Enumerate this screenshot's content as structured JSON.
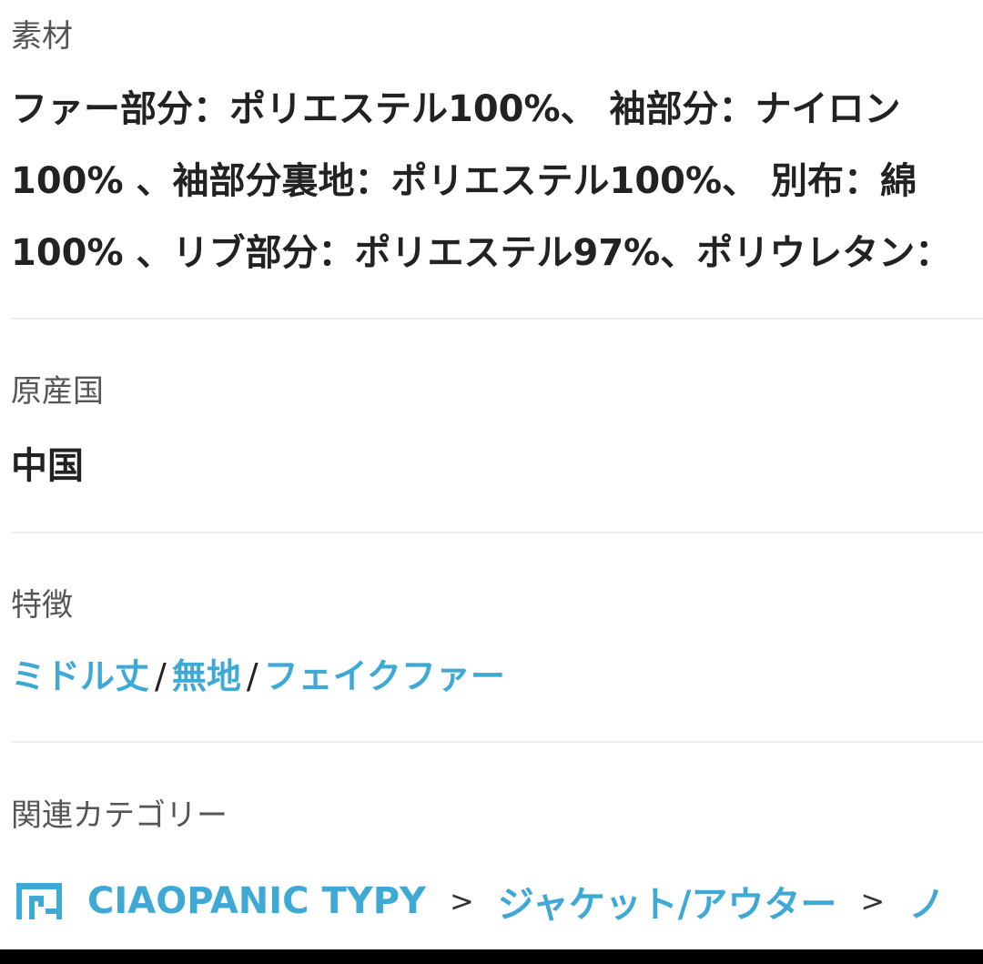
{
  "material": {
    "label": "素材",
    "lines": [
      "ファー部分：ポリエステル100%、 袖部分：ナイロン",
      "100% 、袖部分裏地：ポリエステル100%、 別布：綿",
      "100% 、リブ部分：ポリエステル97%、ポリウレタン："
    ]
  },
  "origin": {
    "label": "原産国",
    "value": "中国"
  },
  "features": {
    "label": "特徴",
    "tags": [
      "ミドル丈",
      "無地",
      "フェイクファー"
    ],
    "separator": "/"
  },
  "related_categories": {
    "label": "関連カテゴリー",
    "icon": "shop-icon",
    "items": [
      "CIAOPANIC TYPY",
      "ジャケット/アウター",
      "ノ"
    ],
    "separator": ">"
  },
  "colors": {
    "link": "#3fa9d6",
    "divider": "#eeeeee",
    "label": "#555555",
    "text": "#222222"
  }
}
